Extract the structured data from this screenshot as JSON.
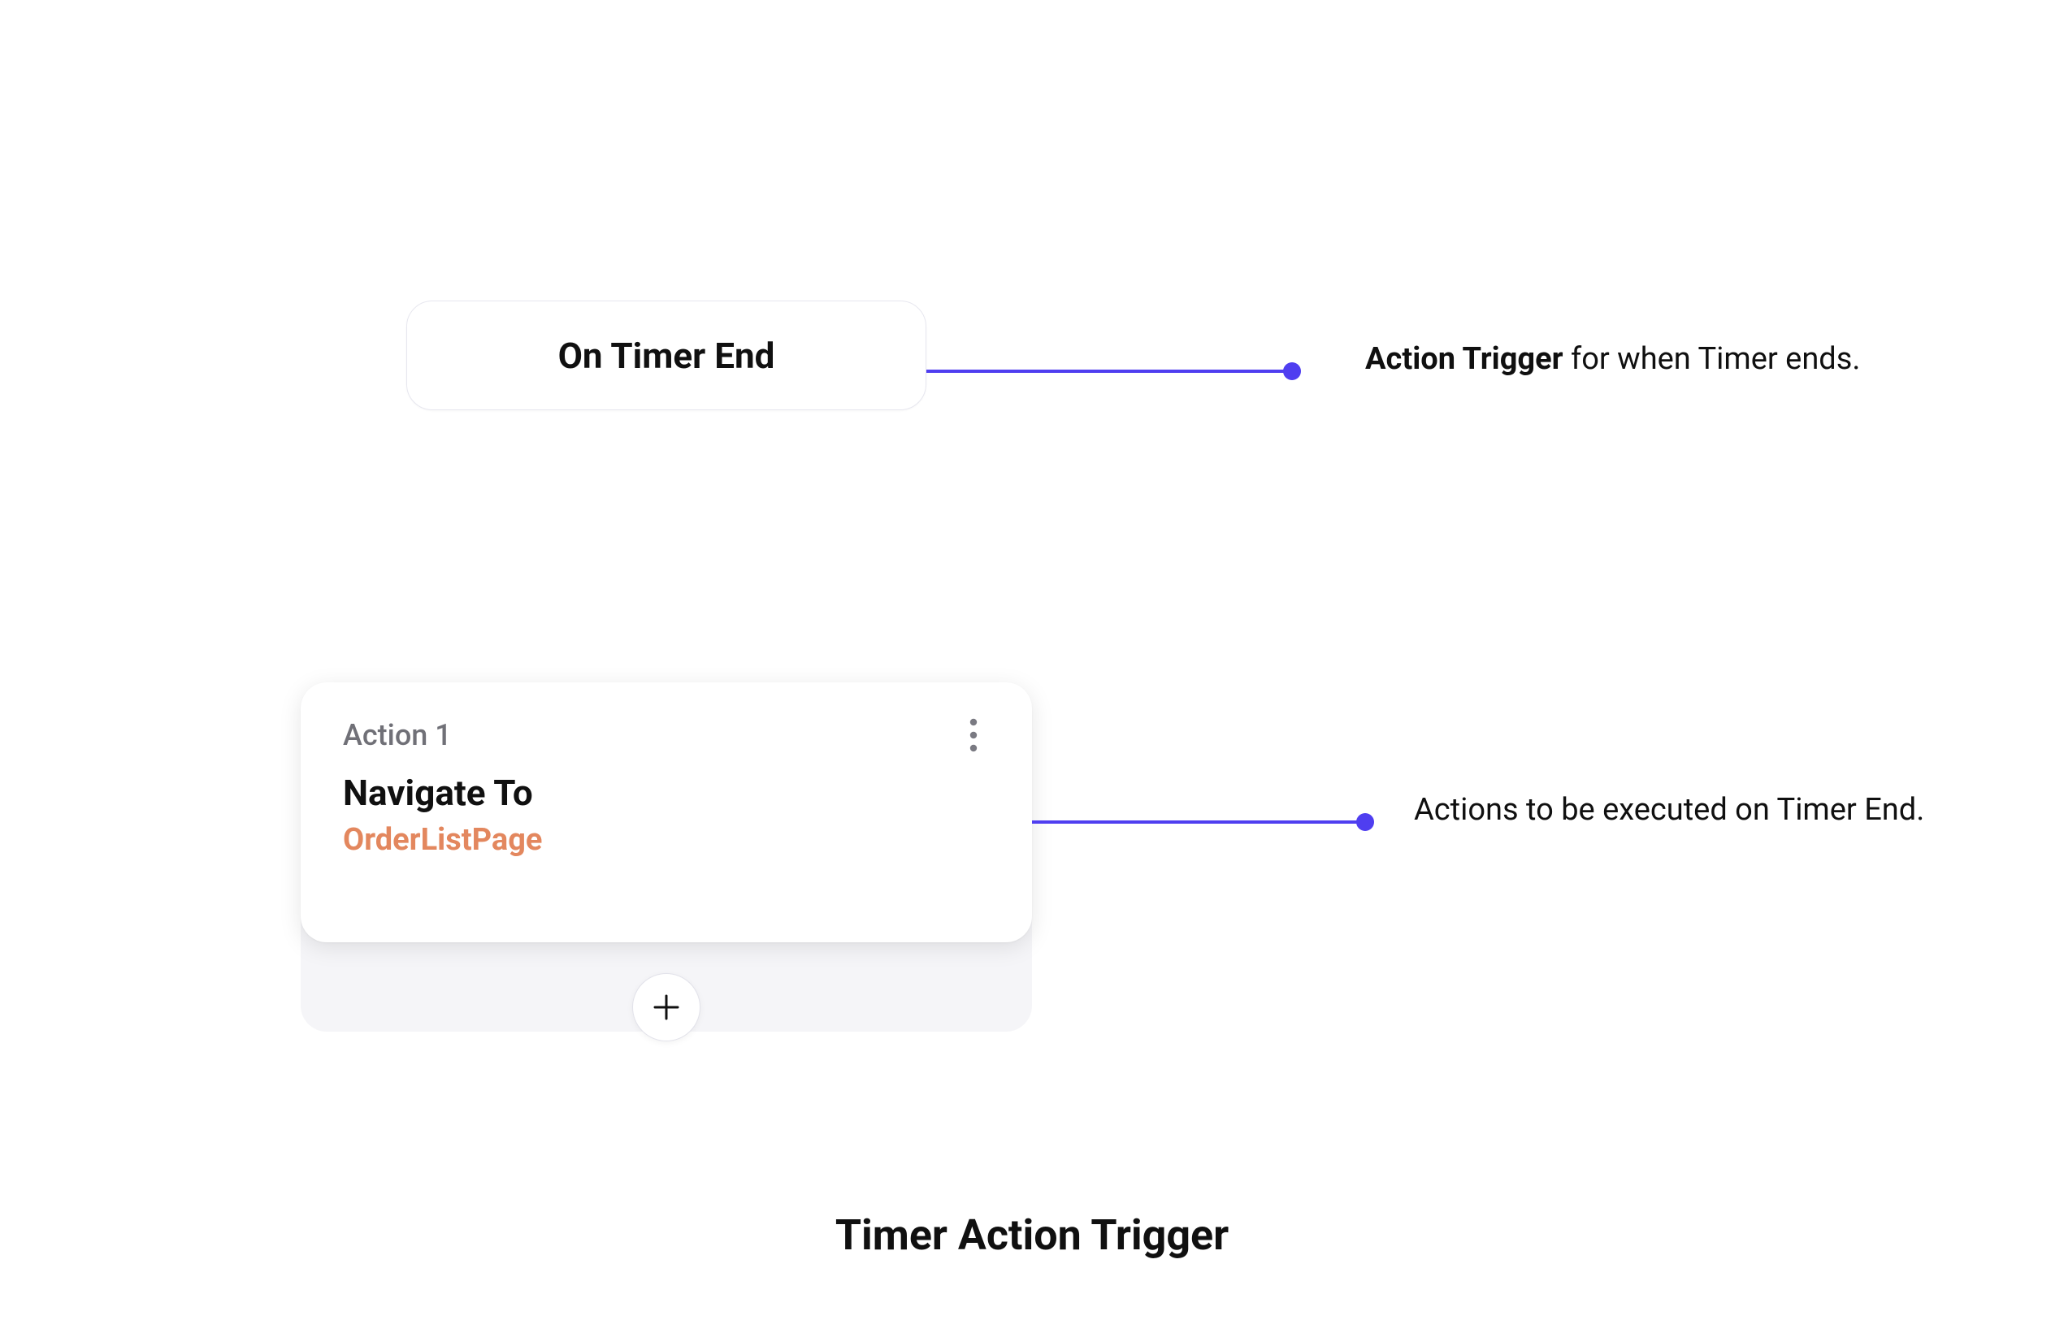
{
  "trigger": {
    "label": "On Timer End"
  },
  "action": {
    "index_label": "Action 1",
    "title": "Navigate To",
    "target": "OrderListPage"
  },
  "annotations": {
    "trigger_bold": "Action Trigger",
    "trigger_rest": " for when Timer ends.",
    "action_text": "Actions to be executed on Timer End."
  },
  "caption": "Timer Action Trigger",
  "colors": {
    "connector": "#4f3ef0",
    "target_accent": "#e3875e"
  }
}
